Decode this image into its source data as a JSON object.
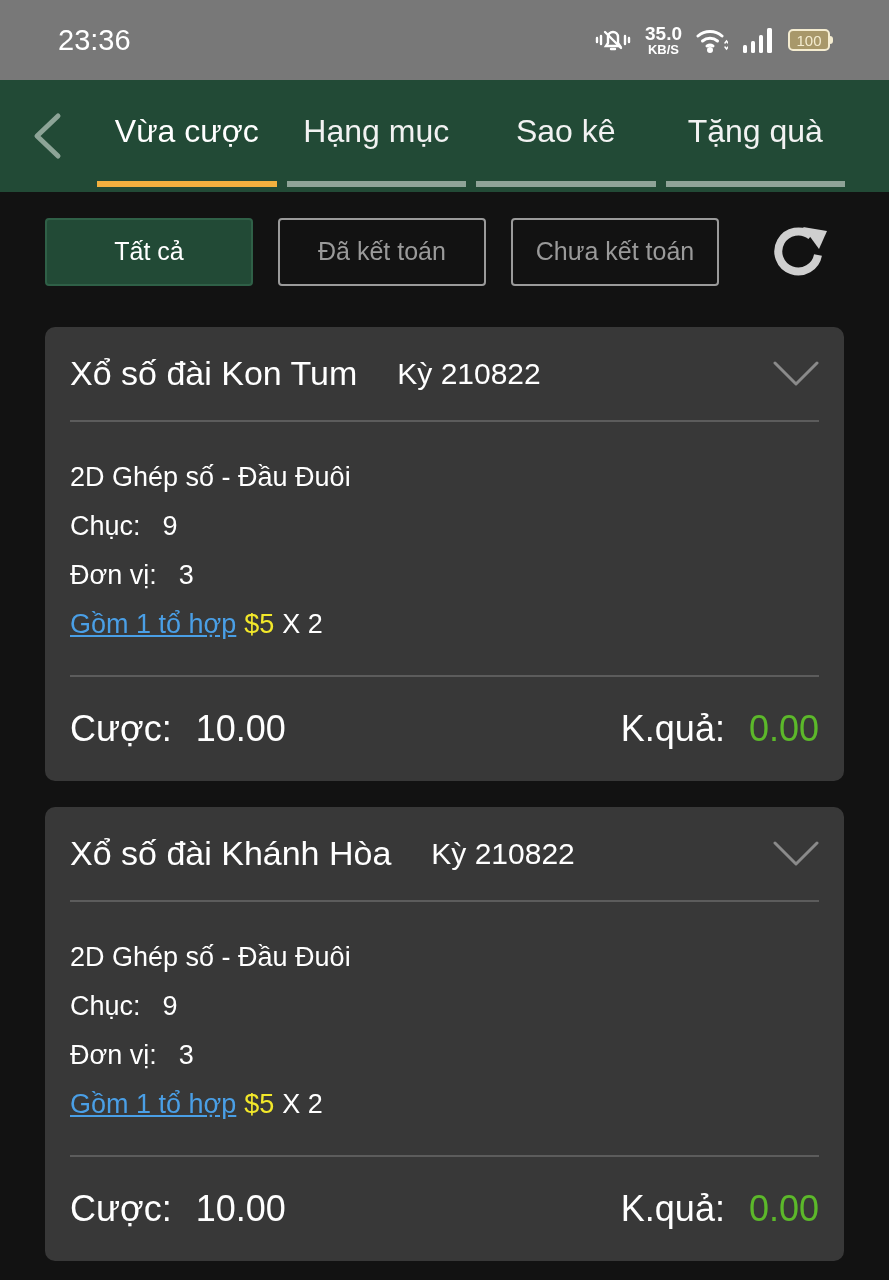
{
  "status_bar": {
    "time": "23:36",
    "net_speed": "35.0",
    "net_unit": "KB/S",
    "battery": "100"
  },
  "tabs": [
    {
      "label": "Vừa cược",
      "selected": true
    },
    {
      "label": "Hạng mục",
      "selected": false
    },
    {
      "label": "Sao kê",
      "selected": false
    },
    {
      "label": "Tặng quà",
      "selected": false
    }
  ],
  "filters": [
    {
      "label": "Tất cả",
      "selected": true
    },
    {
      "label": "Đã kết toán",
      "selected": false
    },
    {
      "label": "Chưa kết toán",
      "selected": false
    }
  ],
  "bets": [
    {
      "title": "Xổ số đài Kon Tum",
      "period": "Kỳ 210822",
      "type": "2D Ghép số - Đầu Đuôi",
      "fields": [
        {
          "label": "Chục:",
          "value": "9"
        },
        {
          "label": "Đơn vị:",
          "value": "3"
        }
      ],
      "combo_link": "Gồm 1 tổ hợp",
      "price": "$5",
      "multiplier": "X 2",
      "stake_label": "Cược:",
      "stake": "10.00",
      "result_label": "K.quả:",
      "result": "0.00"
    },
    {
      "title": "Xổ số đài Khánh Hòa",
      "period": "Kỳ 210822",
      "type": "2D Ghép số - Đầu Đuôi",
      "fields": [
        {
          "label": "Chục:",
          "value": "9"
        },
        {
          "label": "Đơn vị:",
          "value": "3"
        }
      ],
      "combo_link": "Gồm 1 tổ hợp",
      "price": "$5",
      "multiplier": "X 2",
      "stake_label": "Cược:",
      "stake": "10.00",
      "result_label": "K.quả:",
      "result": "0.00"
    }
  ]
}
